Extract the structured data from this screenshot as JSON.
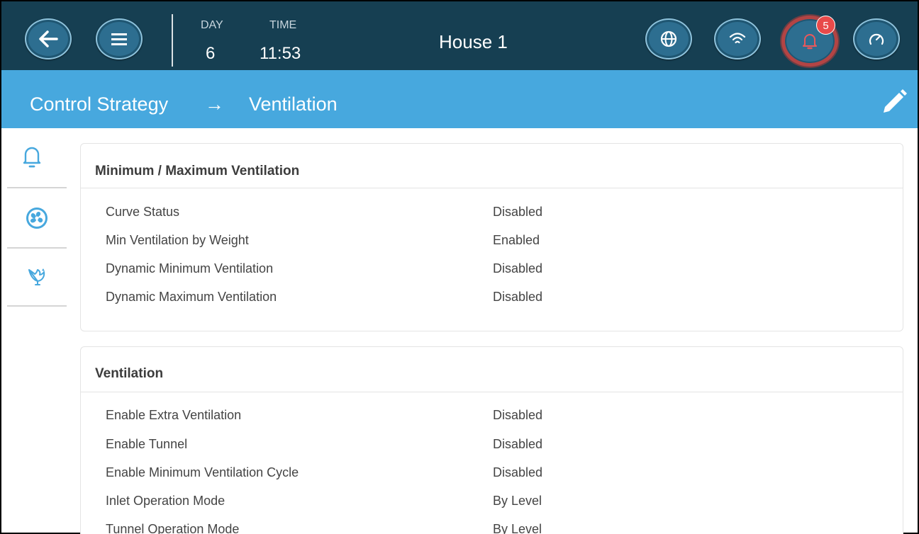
{
  "header": {
    "day_label": "DAY",
    "day_value": "6",
    "time_label": "TIME",
    "time_value": "11:53",
    "house_title": "House 1",
    "alarm_count": "5",
    "icons": [
      "back-arrow-icon",
      "menu-icon",
      "globe-icon",
      "wifi-icon",
      "bell-icon",
      "gauge-icon"
    ]
  },
  "breadcrumb": {
    "parent": "Control Strategy",
    "separator": "→",
    "current": "Ventilation",
    "edit_icon": "pencil-icon"
  },
  "sidebar": {
    "items": [
      {
        "icon": "bell-icon",
        "selected": true
      },
      {
        "icon": "fan-icon",
        "selected": false
      },
      {
        "icon": "bird-icon",
        "selected": false
      }
    ]
  },
  "sections": [
    {
      "title": "Minimum / Maximum Ventilation",
      "rows": [
        {
          "label": "Curve Status",
          "value": "Disabled"
        },
        {
          "label": "Min Ventilation by Weight",
          "value": "Enabled"
        },
        {
          "label": "Dynamic Minimum Ventilation",
          "value": "Disabled"
        },
        {
          "label": "Dynamic Maximum Ventilation",
          "value": "Disabled"
        }
      ]
    },
    {
      "title": "Ventilation",
      "rows": [
        {
          "label": "Enable Extra Ventilation",
          "value": "Disabled"
        },
        {
          "label": "Enable Tunnel",
          "value": "Disabled"
        },
        {
          "label": "Enable Minimum Ventilation Cycle",
          "value": "Disabled"
        },
        {
          "label": "Inlet Operation Mode",
          "value": "By Level"
        },
        {
          "label": "Tunnel Operation Mode",
          "value": "By Level"
        }
      ]
    }
  ],
  "colors": {
    "topbar": "#163f52",
    "button": "#2d6e90",
    "breadcrumb_bar": "#47a8de",
    "accent": "#47a8de",
    "alarm_ring": "#b34444",
    "badge": "#e84a4a"
  }
}
